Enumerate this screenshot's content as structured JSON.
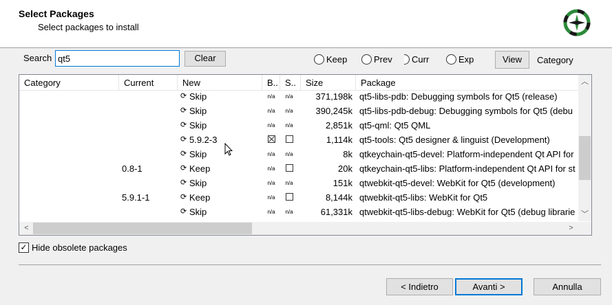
{
  "header": {
    "title": "Select Packages",
    "subtitle": "Select packages to install",
    "logo_icon": "cygwin-logo-icon"
  },
  "search": {
    "label": "Search",
    "value": "qt5",
    "clear_label": "Clear"
  },
  "view_options": {
    "radios": [
      {
        "label": "Keep",
        "selected": false
      },
      {
        "label": "Prev",
        "selected": false
      },
      {
        "label": "Curr",
        "selected": false
      },
      {
        "label": "Exp",
        "selected": false
      }
    ],
    "view_button": "View",
    "view_mode": "Category"
  },
  "columns": [
    "Category",
    "Current",
    "New",
    "B..",
    "S..",
    "Size",
    "Package"
  ],
  "rows": [
    {
      "current": "",
      "new": "Skip",
      "b": "n/a",
      "s": "n/a",
      "size": "371,198k",
      "package": "qt5-libs-pdb: Debugging symbols for Qt5 (release)"
    },
    {
      "current": "",
      "new": "Skip",
      "b": "n/a",
      "s": "n/a",
      "size": "390,245k",
      "package": "qt5-libs-pdb-debug: Debugging symbols for Qt5 (debu"
    },
    {
      "current": "",
      "new": "Skip",
      "b": "n/a",
      "s": "n/a",
      "size": "2,851k",
      "package": "qt5-qml: Qt5 QML"
    },
    {
      "current": "",
      "new": "5.9.2-3",
      "b": "checked",
      "s": "unchecked",
      "size": "1,114k",
      "package": "qt5-tools: Qt5 designer & linguist (Development)"
    },
    {
      "current": "",
      "new": "Skip",
      "b": "n/a",
      "s": "n/a",
      "size": "8k",
      "package": "qtkeychain-qt5-devel: Platform-independent Qt API for"
    },
    {
      "current": "0.8-1",
      "new": "Keep",
      "b": "n/a",
      "s": "unchecked",
      "size": "20k",
      "package": "qtkeychain-qt5-libs: Platform-independent Qt API for st"
    },
    {
      "current": "",
      "new": "Skip",
      "b": "n/a",
      "s": "n/a",
      "size": "151k",
      "package": "qtwebkit-qt5-devel: WebKit for Qt5 (development)"
    },
    {
      "current": "5.9.1-1",
      "new": "Keep",
      "b": "n/a",
      "s": "unchecked",
      "size": "8,144k",
      "package": "qtwebkit-qt5-libs: WebKit for Qt5"
    },
    {
      "current": "",
      "new": "Skip",
      "b": "n/a",
      "s": "n/a",
      "size": "61,331k",
      "package": "qtwebkit-qt5-libs-debug: WebKit for Qt5 (debug librarie"
    }
  ],
  "hide_obsolete": {
    "label": "Hide obsolete packages",
    "checked": true
  },
  "footer": {
    "back_label": "< Indietro",
    "next_label": "Avanti >",
    "cancel_label": "Annulla"
  }
}
